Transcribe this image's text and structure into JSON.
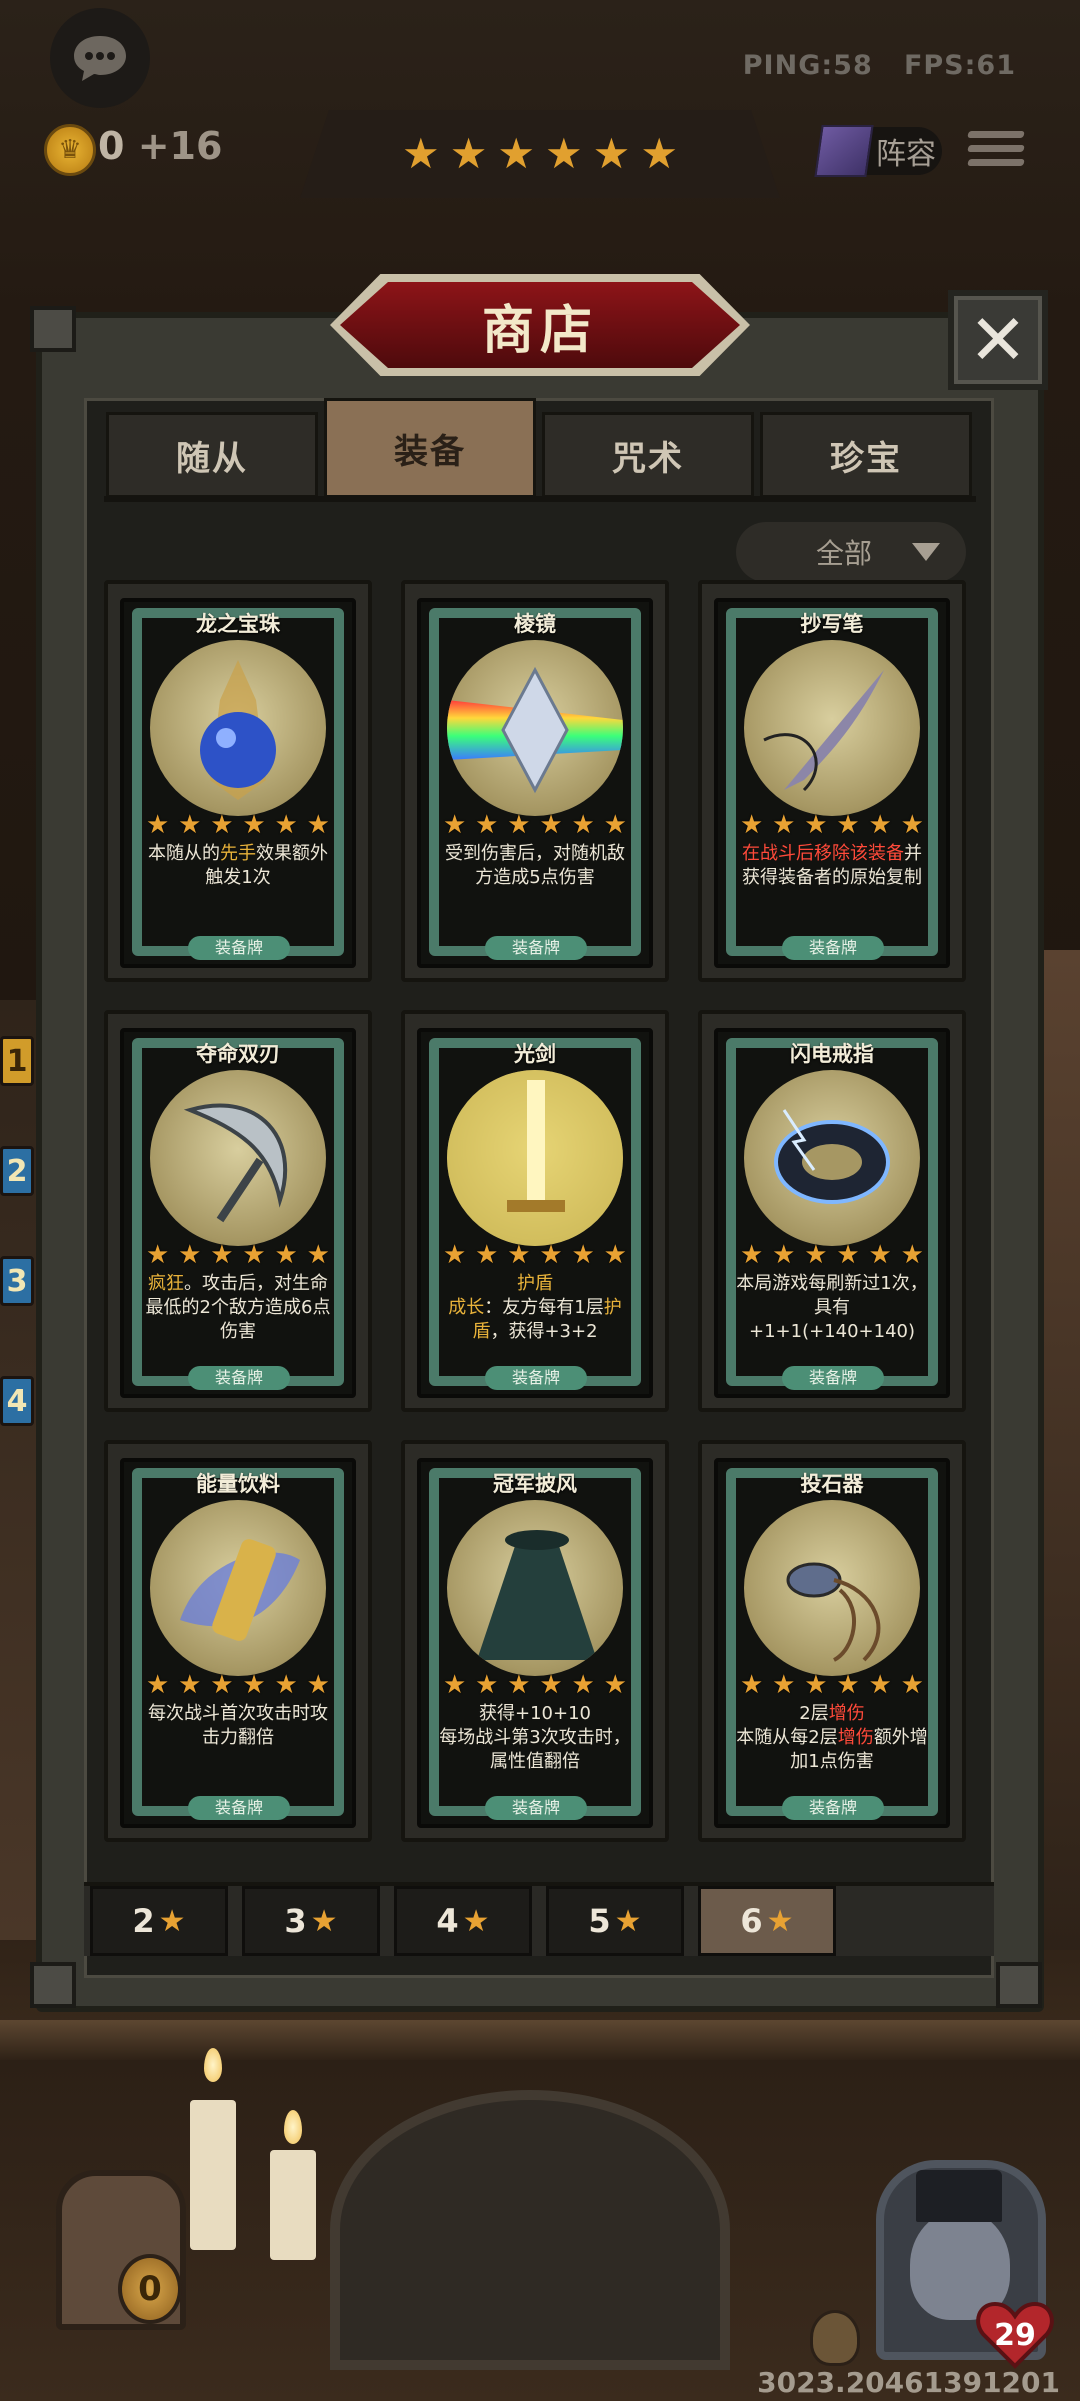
{
  "top_bar": {
    "chat_icon": "chat-bubble-icon",
    "ping": "PING:58",
    "fps": "FPS:61",
    "coins": "0",
    "coin_delta": "+16",
    "tavern_stars": 6,
    "lineup_label": "阵容",
    "menu_icon": "hamburger-icon"
  },
  "shop": {
    "title": "商店",
    "close_icon": "close-icon",
    "tabs": [
      {
        "label": "随从",
        "active": false
      },
      {
        "label": "装备",
        "active": true
      },
      {
        "label": "咒术",
        "active": false
      },
      {
        "label": "珍宝",
        "active": false
      }
    ],
    "filter": {
      "label": "全部",
      "icon": "dropdown-arrow-icon"
    },
    "cards": [
      {
        "name": "龙之宝珠",
        "stars": 6,
        "desc": [
          "本随从的",
          "先手",
          "效果额外触发1次"
        ],
        "type": "装备牌"
      },
      {
        "name": "棱镜",
        "stars": 6,
        "desc": [
          "受到伤害后，对随机敌方造成5点伤害"
        ],
        "type": "装备牌"
      },
      {
        "name": "抄写笔",
        "stars": 6,
        "desc": [
          "在战斗后移除该装备",
          "并获得装备者的原始复制"
        ],
        "type": "装备牌"
      },
      {
        "name": "夺命双刃",
        "stars": 6,
        "desc": [
          "疯狂",
          "。攻击后，对生命最低的2个敌方造成6点伤害"
        ],
        "type": "装备牌"
      },
      {
        "name": "光剑",
        "stars": 6,
        "desc": [
          "护盾",
          "成长",
          "：友方每有1层",
          "护盾",
          "，获得+3+2"
        ],
        "type": "装备牌"
      },
      {
        "name": "闪电戒指",
        "stars": 6,
        "desc": [
          "本局游戏每刷新过1次，具有+1+1(+140+140)"
        ],
        "type": "装备牌"
      },
      {
        "name": "能量饮料",
        "stars": 6,
        "desc": [
          "每次战斗首次攻击时攻击力翻倍"
        ],
        "type": "装备牌"
      },
      {
        "name": "冠军披风",
        "stars": 6,
        "desc": [
          "获得+10+10",
          "每场战斗第3次攻击时，属性值翻倍"
        ],
        "type": "装备牌"
      },
      {
        "name": "投石器",
        "stars": 6,
        "desc": [
          "2层",
          "增伤",
          "本随从每2层",
          "增伤",
          "额外增加1点伤害"
        ],
        "type": "装备牌"
      }
    ],
    "star_tabs": [
      {
        "label": "2",
        "active": false
      },
      {
        "label": "3",
        "active": false
      },
      {
        "label": "4",
        "active": false
      },
      {
        "label": "5",
        "active": false
      },
      {
        "label": "6",
        "active": true
      }
    ]
  },
  "side_badges": [
    "1",
    "2",
    "3",
    "4"
  ],
  "bottom": {
    "gold_count": "0",
    "hero_hp": "29",
    "build_id": "3023.20461391201"
  },
  "colors": {
    "star": "#e8a233",
    "card_frame": "#4b7a69",
    "highlight_yellow": "#e8b23a",
    "highlight_red": "#ff4a3a",
    "title_banner": "#8d1418"
  }
}
